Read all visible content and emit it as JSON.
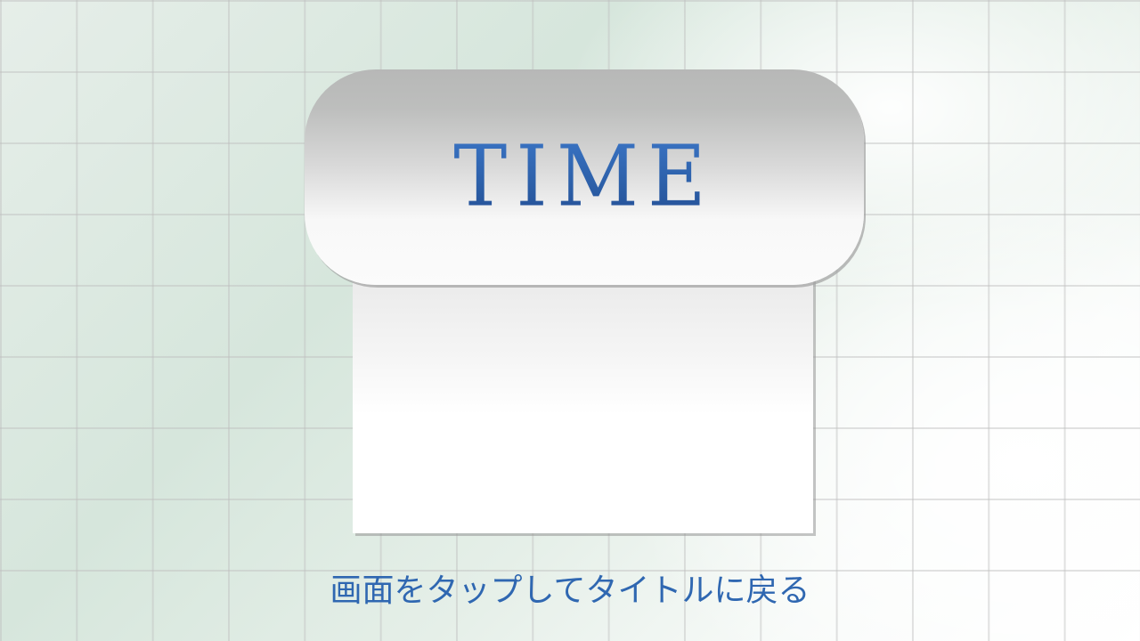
{
  "screen": {
    "title": "TIME",
    "hint": "画面をタップしてタイトルに戻る"
  },
  "colors": {
    "title_text": "#2c5fa8",
    "hint_text": "#2f67b1",
    "background_tint": "#d6e6dc"
  }
}
